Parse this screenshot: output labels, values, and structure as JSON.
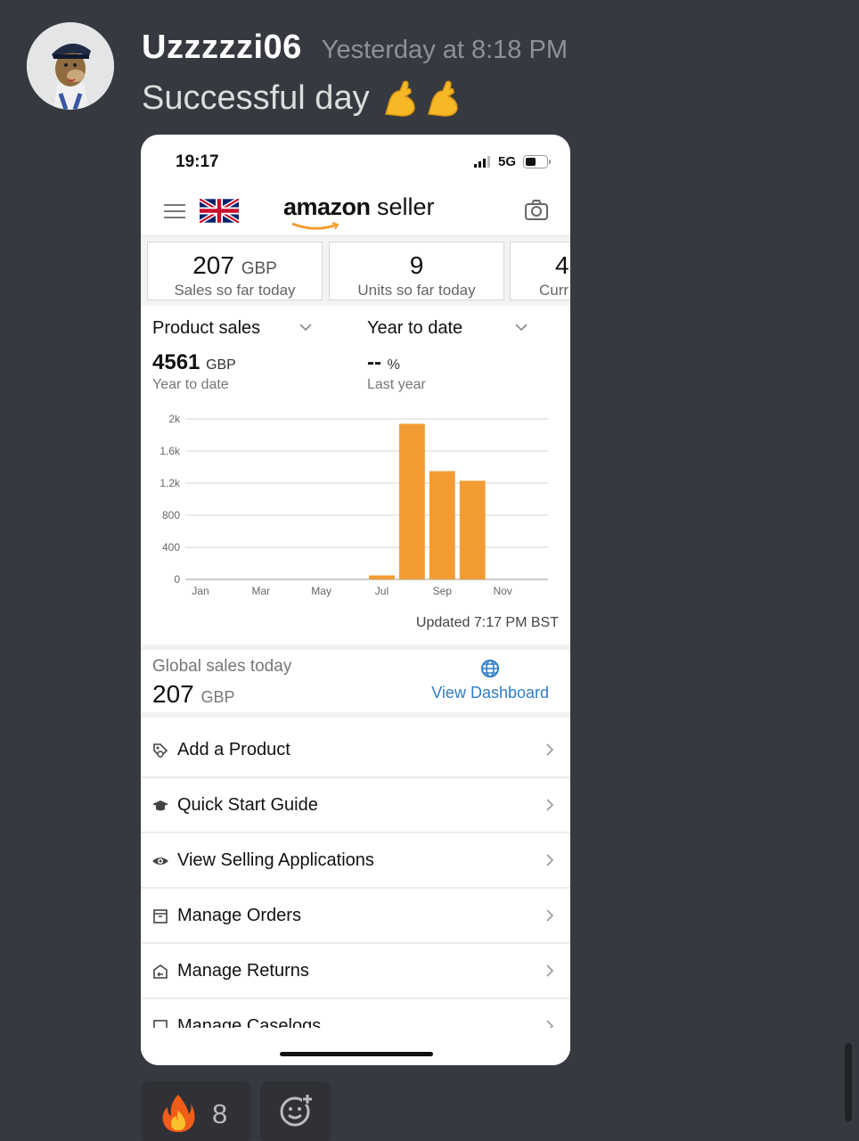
{
  "message": {
    "username": "Uzzzzzi06",
    "timestamp": "Yesterday at 8:18 PM",
    "text": "Successful day",
    "emoji": "flexed-biceps-emoji x2"
  },
  "phone": {
    "status": {
      "time": "19:17",
      "network": "5G"
    },
    "header": {
      "logo_word": "amazon",
      "logo_rest": " seller"
    },
    "cards": [
      {
        "value": "207",
        "unit": "GBP",
        "label": "Sales so far today"
      },
      {
        "value": "9",
        "unit": "",
        "label": "Units so far today"
      },
      {
        "value": "4",
        "unit": "",
        "label": "Curr"
      }
    ],
    "panel": {
      "left_select": "Product sales",
      "right_select": "Year to date",
      "left_value": "4561",
      "left_unit": "GBP",
      "left_sub": "Year to date",
      "right_value": "--",
      "right_unit": "%",
      "right_sub": "Last year",
      "updated": "Updated 7:17 PM BST"
    },
    "global": {
      "label": "Global sales today",
      "value": "207",
      "unit": "GBP",
      "link": "View Dashboard"
    },
    "menu": [
      {
        "label": "Add a Product",
        "icon": "tag-icon"
      },
      {
        "label": "Quick Start Guide",
        "icon": "graduation-cap-icon"
      },
      {
        "label": "View Selling Applications",
        "icon": "eye-icon"
      },
      {
        "label": "Manage Orders",
        "icon": "box-icon"
      },
      {
        "label": "Manage Returns",
        "icon": "return-box-icon"
      },
      {
        "label": "Manage Caselogs",
        "icon": "case-icon"
      }
    ]
  },
  "reactions": [
    {
      "emoji": "fire-emoji",
      "count": "8"
    }
  ],
  "colors": {
    "bar": "#f39c33",
    "link": "#2f7ec9",
    "discord_bg": "#36393f"
  },
  "chart_data": {
    "type": "bar",
    "categories": [
      "Jan",
      "Feb",
      "Mar",
      "Apr",
      "May",
      "Jun",
      "Jul",
      "Aug",
      "Sep",
      "Oct",
      "Nov",
      "Dec"
    ],
    "x_tick_labels": [
      "Jan",
      "Mar",
      "May",
      "Jul",
      "Sep",
      "Nov"
    ],
    "values": [
      0,
      0,
      0,
      0,
      0,
      0,
      50,
      1940,
      1350,
      1230,
      0,
      0
    ],
    "y_ticks": [
      "0",
      "400",
      "800",
      "1.2k",
      "1.6k",
      "2k"
    ],
    "ylim": [
      0,
      2000
    ],
    "grid": true
  }
}
